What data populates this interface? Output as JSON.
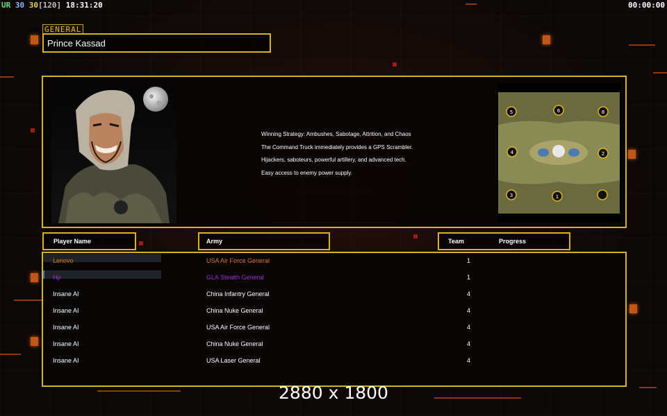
{
  "hud": {
    "left": {
      "ur": "UR",
      "v1": "30",
      "v2": "30",
      "v3": "[120]",
      "clock": "18:31:20"
    },
    "right": "00:00:00"
  },
  "general": {
    "tag": "GENERAL",
    "name": "Prince Kassad"
  },
  "strategy": {
    "lines": [
      "Winning Strategy: Ambushes, Sabotage, Attrition, and Chaos",
      "The Command Truck immediately provides a GPS Scrambler.",
      "Hijackers, saboteurs, powerful artillery, and advanced tech.",
      "Easy access to enemy power supply."
    ]
  },
  "map": {
    "slots": [
      "1",
      "2",
      "3",
      "4",
      "5",
      "6",
      "8"
    ]
  },
  "headers": {
    "player_name": "Player Name",
    "army": "Army",
    "team": "Team",
    "progress": "Progress"
  },
  "players": [
    {
      "name": "Lenovo",
      "army": "USA Air Force General",
      "team": "1",
      "color": "#e07a1a",
      "progress": 0.0
    },
    {
      "name": "Hp",
      "army": "GLA Stealth General",
      "team": "1",
      "color": "#a02ad8",
      "progress": 0.01
    },
    {
      "name": "Insane AI",
      "army": "China Infantry General",
      "team": "4",
      "color": "#ffffff",
      "progress": null
    },
    {
      "name": "Insane AI",
      "army": "China Nuke General",
      "team": "4",
      "color": "#ffffff",
      "progress": null
    },
    {
      "name": "Insane AI",
      "army": "USA Air Force General",
      "team": "4",
      "color": "#ffffff",
      "progress": null
    },
    {
      "name": "Insane AI",
      "army": "China Nuke General",
      "team": "4",
      "color": "#ffffff",
      "progress": null
    },
    {
      "name": "Insane AI",
      "army": "USA Laser General",
      "team": "4",
      "color": "#ffffff",
      "progress": null
    }
  ],
  "watermark": "2880 x 1800",
  "colors": {
    "frame": "#d8b323",
    "accent": "#f06a1a",
    "background": "#0c0808"
  }
}
